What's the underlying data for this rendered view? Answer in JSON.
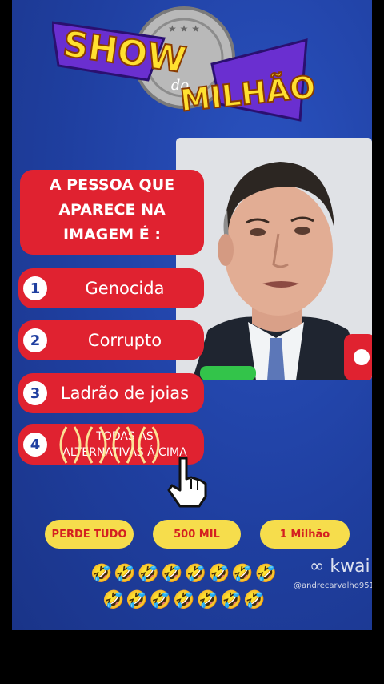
{
  "logo": {
    "word1": "SHOW",
    "word2": "do",
    "word3": "MILHÃO"
  },
  "question": {
    "lines": [
      "A PESSOA QUE",
      "APARECE NA",
      "IMAGEM É :"
    ]
  },
  "options": [
    {
      "num": "1",
      "label": "Genocida"
    },
    {
      "num": "2",
      "label": "Corrupto"
    },
    {
      "num": "3",
      "label": "Ladrão de joias"
    },
    {
      "num": "4",
      "label_line1": "TODAS AS",
      "label_line2": "ALTERNATIVAS Á CIMA"
    }
  ],
  "prizes": {
    "lose": "PERDE TUDO",
    "mid": "500 MIL",
    "top": "1 Milhão"
  },
  "emojis": {
    "row1": "🤣🤣🤣🤣🤣🤣🤣🤣",
    "row2": "🤣🤣🤣🤣🤣🤣🤣"
  },
  "watermark": {
    "brand": "kwai",
    "handle": "@andrecarvalho951"
  },
  "colors": {
    "background": "#1f3fa0",
    "button_red": "#e02230",
    "prize_yellow": "#f6dd4c",
    "logo_yellow": "#ffe030",
    "logo_purple": "#6a2fd0"
  }
}
